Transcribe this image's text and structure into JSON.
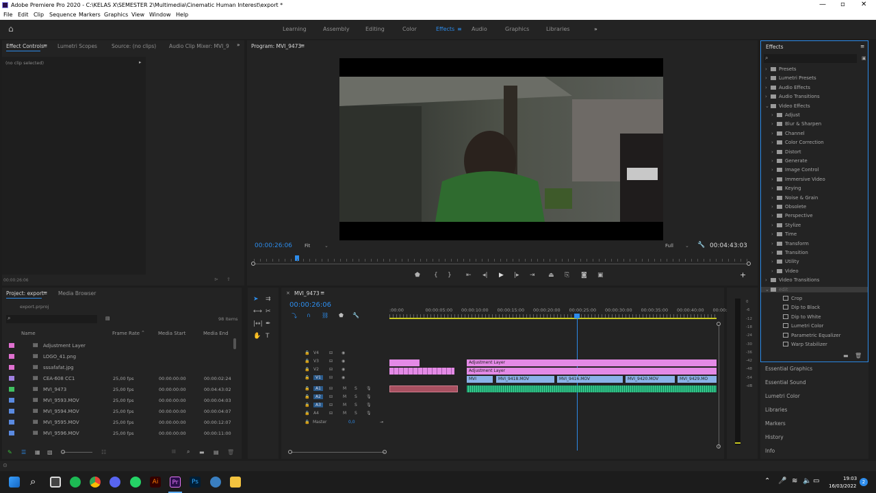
{
  "window": {
    "title": "Adobe Premiere Pro 2020 - C:\\KELAS X\\SEMESTER 2\\Multimedia\\Cinematic Human Interest\\export *"
  },
  "menu": [
    "File",
    "Edit",
    "Clip",
    "Sequence",
    "Markers",
    "Graphics",
    "View",
    "Window",
    "Help"
  ],
  "workspaces": {
    "items": [
      "Learning",
      "Assembly",
      "Editing",
      "Color",
      "Effects",
      "Audio",
      "Graphics",
      "Libraries"
    ],
    "active": "Effects",
    "more": "»"
  },
  "source_panel": {
    "tabs": [
      "Effect Controls",
      "Lumetri Scopes",
      "Source: (no clips)",
      "Audio Clip Mixer: MVI_9"
    ],
    "no_clip": "(no clip selected)",
    "timecode": "00:00:26:06"
  },
  "program": {
    "title": "Program: MVI_9473",
    "timecode": "00:00:26:06",
    "fit": "Fit",
    "quality": "Full",
    "duration": "00:04:43:03"
  },
  "effects": {
    "title": "Effects",
    "tree": [
      {
        "label": "Presets",
        "level": 0
      },
      {
        "label": "Lumetri Presets",
        "level": 0
      },
      {
        "label": "Audio Effects",
        "level": 0
      },
      {
        "label": "Audio Transitions",
        "level": 0
      },
      {
        "label": "Video Effects",
        "level": 0,
        "open": true
      },
      {
        "label": "Adjust",
        "level": 1
      },
      {
        "label": "Blur & Sharpen",
        "level": 1
      },
      {
        "label": "Channel",
        "level": 1
      },
      {
        "label": "Color Correction",
        "level": 1
      },
      {
        "label": "Distort",
        "level": 1
      },
      {
        "label": "Generate",
        "level": 1
      },
      {
        "label": "Image Control",
        "level": 1
      },
      {
        "label": "Immersive Video",
        "level": 1
      },
      {
        "label": "Keying",
        "level": 1
      },
      {
        "label": "Noise & Grain",
        "level": 1
      },
      {
        "label": "Obsolete",
        "level": 1
      },
      {
        "label": "Perspective",
        "level": 1
      },
      {
        "label": "Stylize",
        "level": 1
      },
      {
        "label": "Time",
        "level": 1
      },
      {
        "label": "Transform",
        "level": 1
      },
      {
        "label": "Transition",
        "level": 1
      },
      {
        "label": "Utility",
        "level": 1
      },
      {
        "label": "Video",
        "level": 1
      },
      {
        "label": "Video Transitions",
        "level": 0
      },
      {
        "label": "edit",
        "level": 0,
        "open": true,
        "selected": true
      },
      {
        "label": "Crop",
        "level": 2
      },
      {
        "label": "Dip to Black",
        "level": 2
      },
      {
        "label": "Dip to White",
        "level": 2
      },
      {
        "label": "Lumetri Color",
        "level": 2
      },
      {
        "label": "Parametric Equalizer",
        "level": 2
      },
      {
        "label": "Warp Stabilizer",
        "level": 2
      }
    ]
  },
  "side_panels": [
    "Essential Graphics",
    "Essential Sound",
    "Lumetri Color",
    "Libraries",
    "Markers",
    "History",
    "Info"
  ],
  "project": {
    "tabs": [
      "Project: export",
      "Media Browser"
    ],
    "file": "export.prproj",
    "count": "98 Items",
    "columns": [
      "Name",
      "Frame Rate",
      "Media Start",
      "Media End"
    ],
    "rows": [
      {
        "color": "#e070d0",
        "name": "Adjustment Layer",
        "fps": "",
        "start": "",
        "end": ""
      },
      {
        "color": "#e070d0",
        "name": "LOGO_41.png",
        "fps": "",
        "start": "",
        "end": ""
      },
      {
        "color": "#e070d0",
        "name": "sssafafat.jpg",
        "fps": "",
        "start": "",
        "end": ""
      },
      {
        "color": "#a080e0",
        "name": "CEA-608 CC1",
        "fps": "25,00 fps",
        "start": "00:00:00:00",
        "end": "00:00:02:24"
      },
      {
        "color": "#40c060",
        "name": "MVI_9473",
        "fps": "25,00 fps",
        "start": "00:00:00:00",
        "end": "00:04:43:02"
      },
      {
        "color": "#5a8ae0",
        "name": "MVI_9593.MOV",
        "fps": "25,00 fps",
        "start": "00:00:00:00",
        "end": "00:00:04:03"
      },
      {
        "color": "#5a8ae0",
        "name": "MVI_9594.MOV",
        "fps": "25,00 fps",
        "start": "00:00:00:00",
        "end": "00:00:04:07"
      },
      {
        "color": "#5a8ae0",
        "name": "MVI_9595.MOV",
        "fps": "25,00 fps",
        "start": "00:00:00:00",
        "end": "00:00:12:07"
      },
      {
        "color": "#5a8ae0",
        "name": "MVI_9596.MOV",
        "fps": "25,00 fps",
        "start": "00:00:00:00",
        "end": "00:00:11:00"
      }
    ]
  },
  "timeline": {
    "title": "MVI_9473",
    "timecode": "00:00:26:06",
    "ruler": [
      ":00:00",
      "00:00:05:00",
      "00:00:10:00",
      "00:00:15:00",
      "00:00:20:00",
      "00:00:25:00",
      "00:00:30:00",
      "00:00:35:00",
      "00:00:40:00",
      "00:00:4"
    ],
    "video_tracks": [
      "V4",
      "V3",
      "V2",
      "V1"
    ],
    "audio_tracks": [
      "A1",
      "A2",
      "A3",
      "A4"
    ],
    "master": "Master",
    "master_val": "0,0",
    "clips": {
      "adj1": "Adjustment Layer",
      "adj2": "Adjustment Layer",
      "v1a": "MVI",
      "v1b": "MVI_9418.MOV",
      "v1c": "MVI_9416.MOV",
      "v1d": "MVI_9420.MOV",
      "v1e": "MVI_9429.MO"
    }
  },
  "meter": {
    "labels": [
      "0",
      "-6",
      "-12",
      "-18",
      "-24",
      "-30",
      "-36",
      "-42",
      "-48",
      "-54",
      "-dB"
    ]
  },
  "taskbar": {
    "time": "19:03",
    "date": "16/03/2022",
    "badge": "2"
  }
}
